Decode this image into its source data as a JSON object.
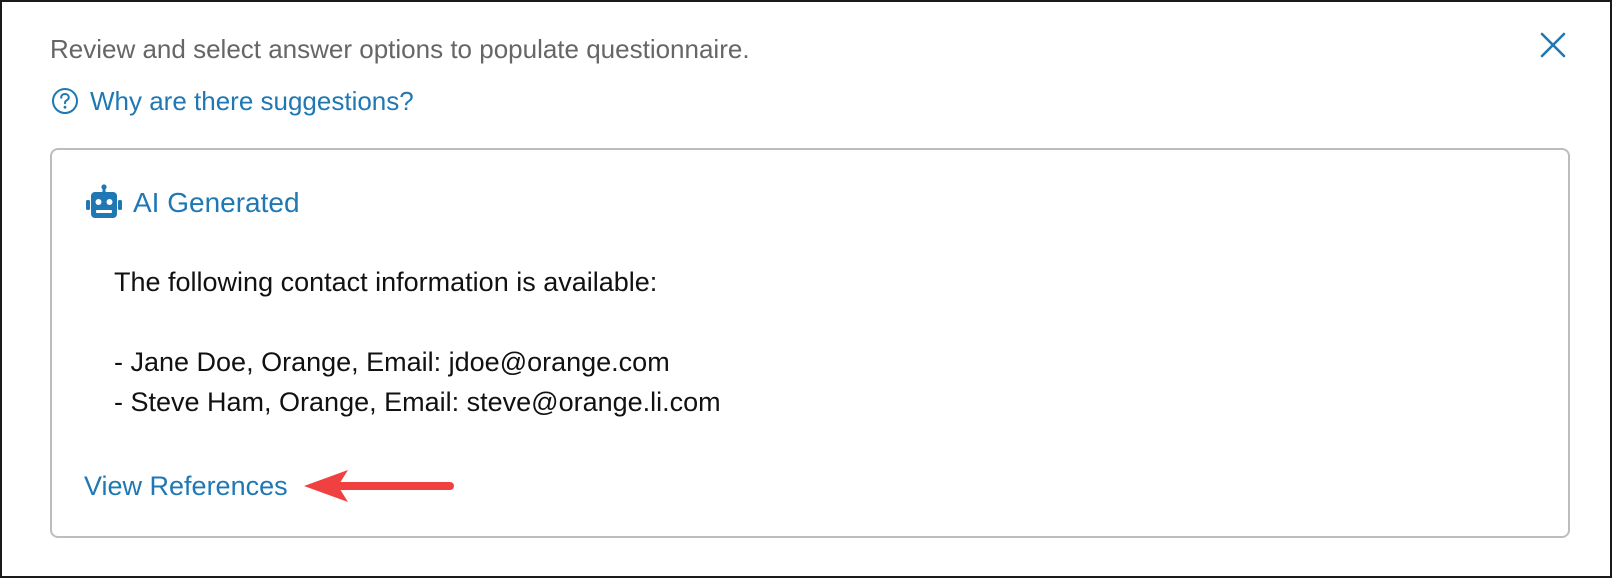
{
  "header": {
    "instruction": "Review and select answer options to populate questionnaire.",
    "close_icon": "close-icon"
  },
  "help": {
    "icon": "question-circle-icon",
    "label": "Why are there suggestions?"
  },
  "card": {
    "badge_icon": "robot-icon",
    "badge_label": "AI Generated",
    "answer": {
      "intro": "The following contact information is available:",
      "contacts": [
        "- Jane Doe, Orange, Email: jdoe@orange.com",
        "- Steve Ham, Orange, Email: steve@orange.li.com"
      ]
    },
    "view_references_label": "View References",
    "annotation_icon": "red-arrow-icon"
  },
  "colors": {
    "link": "#1f78b4",
    "muted_text": "#666666",
    "body_text": "#111111",
    "card_border": "#bdbdbd",
    "annotation": "#f04040"
  }
}
